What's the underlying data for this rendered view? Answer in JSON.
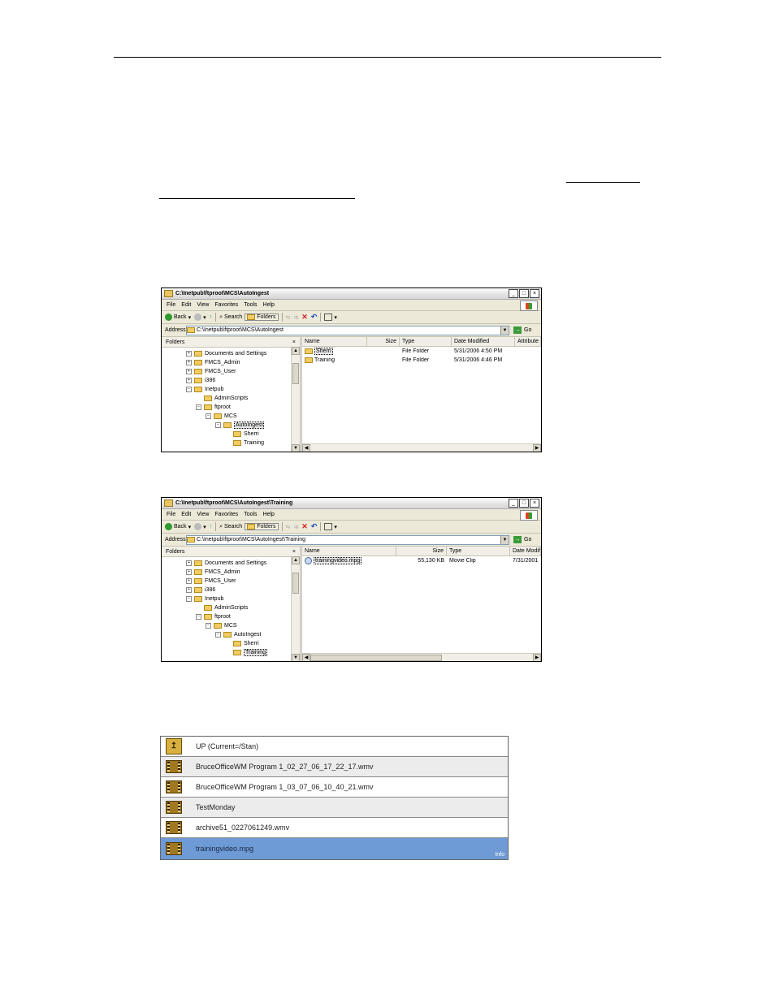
{
  "win1": {
    "title": "C:\\Inetpub\\ftproot\\MCS\\AutoIngest",
    "menus": [
      "File",
      "Edit",
      "View",
      "Favorites",
      "Tools",
      "Help"
    ],
    "toolbar": {
      "back": "Back",
      "search": "Search",
      "folders": "Folders"
    },
    "address_label": "Address",
    "address": "C:\\Inetpub\\ftproot\\MCS\\AutoIngest",
    "go": "Go",
    "folders_label": "Folders",
    "close_x": "×",
    "tree": [
      "Documents and Settings",
      "FMCS_Admin",
      "FMCS_User",
      "i386",
      "Inetpub",
      "AdminScripts",
      "ftproot",
      "MCS",
      "AutoIngest",
      "Sherri",
      "Training"
    ],
    "columns": [
      "Name",
      "Size",
      "Type",
      "Date Modified",
      "Attribute"
    ],
    "files": [
      {
        "name": "Sherri",
        "size": "",
        "type": "File Folder",
        "date": "5/31/2006 4:50 PM"
      },
      {
        "name": "Training",
        "size": "",
        "type": "File Folder",
        "date": "5/31/2006 4:46 PM"
      }
    ]
  },
  "win2": {
    "title": "C:\\Inetpub\\ftproot\\MCS\\AutoIngest\\Training",
    "menus": [
      "File",
      "Edit",
      "View",
      "Favorites",
      "Tools",
      "Help"
    ],
    "toolbar": {
      "back": "Back",
      "search": "Search",
      "folders": "Folders"
    },
    "address_label": "Address",
    "address": "C:\\Inetpub\\ftproot\\MCS\\AutoIngest\\Training",
    "go": "Go",
    "folders_label": "Folders",
    "close_x": "×",
    "tree": [
      "Documents and Settings",
      "FMCS_Admin",
      "FMCS_User",
      "i386",
      "Inetpub",
      "AdminScripts",
      "ftproot",
      "MCS",
      "AutoIngest",
      "Sherri",
      "Training"
    ],
    "columns": [
      "Name",
      "Size",
      "Type",
      "Date Modifi"
    ],
    "files": [
      {
        "name": "trainingvideo.mpg",
        "size": "55,130 KB",
        "type": "Movie Clip",
        "date": "7/31/2001"
      }
    ]
  },
  "media_list": {
    "items": [
      {
        "label": "UP (Current=/Stan)",
        "icon": "up-folder-icon"
      },
      {
        "label": "BruceOfficeWM Program 1_02_27_06_17_22_17.wmv",
        "icon": "film-icon"
      },
      {
        "label": "BruceOfficeWM Program 1_03_07_06_10_40_21.wmv",
        "icon": "film-icon"
      },
      {
        "label": "TestMonday",
        "icon": "film-icon"
      },
      {
        "label": "archive51_0227061249.wmv",
        "icon": "film-icon"
      },
      {
        "label": "trainingvideo.mpg",
        "icon": "film-icon"
      }
    ],
    "info": "Info",
    "colors": {
      "selected": "#6e9ad6",
      "row_alt": "#ececec",
      "row": "#ffffff"
    }
  }
}
